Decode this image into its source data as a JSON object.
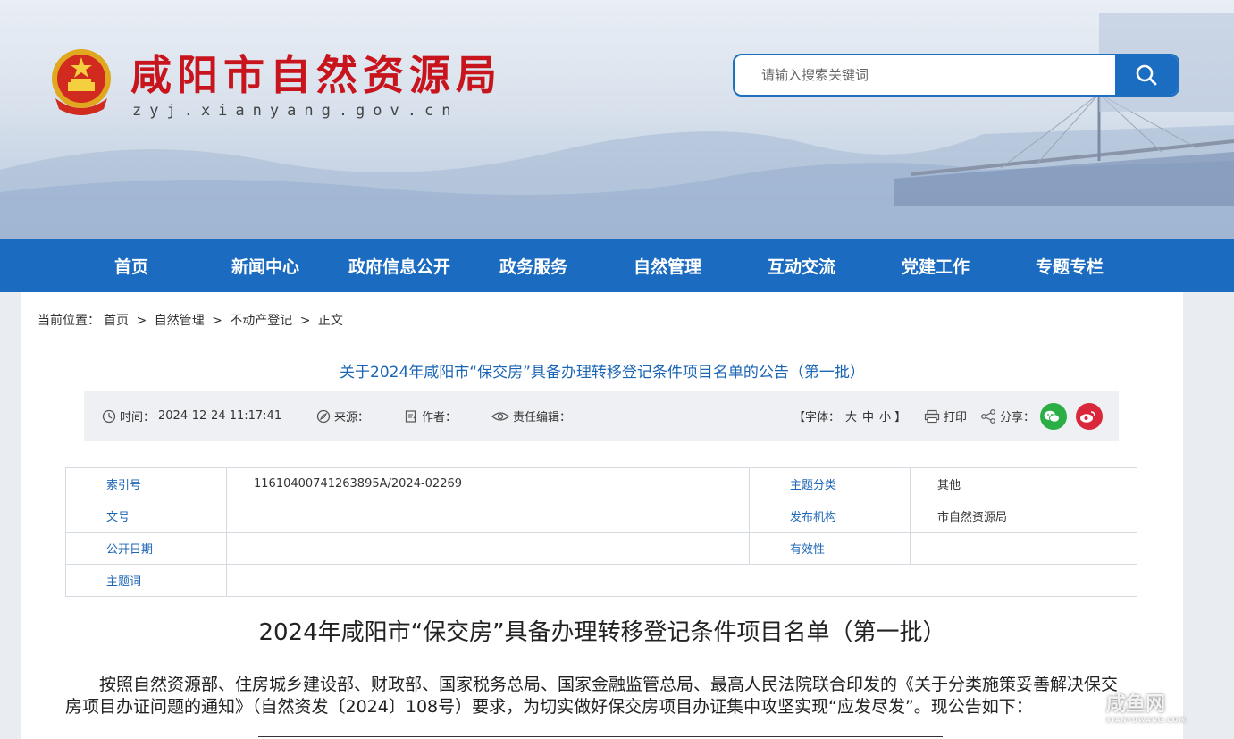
{
  "header": {
    "site_title": "咸阳市自然资源局",
    "site_domain": "zyj.xianyang.gov.cn",
    "search_placeholder": "请输入搜索关键词"
  },
  "nav": {
    "items": [
      "首页",
      "新闻中心",
      "政府信息公开",
      "政务服务",
      "自然管理",
      "互动交流",
      "党建工作",
      "专题专栏"
    ]
  },
  "breadcrumb": {
    "prefix": "当前位置：",
    "items": [
      "首页",
      "自然管理",
      "不动产登记",
      "正文"
    ],
    "separator": ">"
  },
  "article": {
    "title": "关于2024年咸阳市“保交房”具备办理转移登记条件项目名单的公告（第一批）",
    "meta": {
      "time_label": "时间：",
      "time_value": "2024-12-24 11:17:41",
      "source_label": "来源：",
      "author_label": "作者：",
      "editor_label": "责任编辑：",
      "font_size_label": "【字体：",
      "font_large": "大",
      "font_medium": "中",
      "font_small": "小",
      "font_close": "】",
      "print_label": "打印",
      "share_label": "分享："
    },
    "info_table": {
      "index_label": "索引号",
      "index_value": "11610400741263895A/2024-02269",
      "category_label": "主题分类",
      "category_value": "其他",
      "doc_no_label": "文号",
      "doc_no_value": "",
      "publisher_label": "发布机构",
      "publisher_value": "市自然资源局",
      "open_date_label": "公开日期",
      "open_date_value": "",
      "validity_label": "有效性",
      "validity_value": "",
      "keywords_label": "主题词",
      "keywords_value": ""
    },
    "doc_heading": "2024年咸阳市“保交房”具备办理转移登记条件项目名单（第一批）",
    "body_paragraph": "按照自然资源部、住房城乡建设部、财政部、国家税务总局、国家金融监管总局、最高人民法院联合印发的《关于分类施策妥善解决保交房项目办证问题的通知》（自然资发〔2024〕108号）要求，为切实做好保交房项目办证集中攻坚实现“应发尽发”。现公告如下："
  },
  "watermark": {
    "main": "咸鱼网",
    "sub": "XIANYUWANG.COM"
  },
  "colors": {
    "brand_red": "#c8151d",
    "nav_blue": "#1b6bc0",
    "title_blue": "#1b65b5",
    "wechat_green": "#2aae45",
    "weibo_red": "#d9283a"
  }
}
